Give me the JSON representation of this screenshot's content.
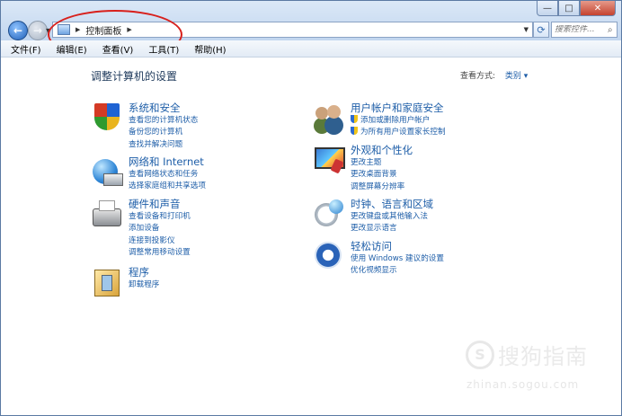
{
  "window": {
    "controls": {
      "minimize": "—",
      "maximize": "□",
      "close": "✕"
    }
  },
  "address_bar": {
    "back": "←",
    "forward": "→",
    "breadcrumb": "控制面板",
    "search_placeholder": "搜索控件..."
  },
  "menu": [
    "文件(F)",
    "编辑(E)",
    "查看(V)",
    "工具(T)",
    "帮助(H)"
  ],
  "page": {
    "title": "调整计算机的设置",
    "view_by_label": "查看方式:",
    "view_by_value": "类别 ▾"
  },
  "categories_left": [
    {
      "icon": "security-shield-icon",
      "title": "系统和安全",
      "links": [
        "查看您的计算机状态",
        "备份您的计算机",
        "查找并解决问题"
      ]
    },
    {
      "icon": "network-globe-icon",
      "title": "网络和 Internet",
      "links": [
        "查看网络状态和任务",
        "选择家庭组和共享选项"
      ]
    },
    {
      "icon": "printer-icon",
      "title": "硬件和声音",
      "links": [
        "查看设备和打印机",
        "添加设备",
        "连接到投影仪",
        "调整常用移动设置"
      ]
    },
    {
      "icon": "programs-icon",
      "title": "程序",
      "links": [
        "卸载程序"
      ]
    }
  ],
  "categories_right": [
    {
      "icon": "users-icon",
      "title": "用户帐户和家庭安全",
      "links": [
        "添加或删除用户帐户",
        "为所有用户设置家长控制"
      ]
    },
    {
      "icon": "display-icon",
      "title": "外观和个性化",
      "links": [
        "更改主题",
        "更改桌面背景",
        "调整屏幕分辨率"
      ]
    },
    {
      "icon": "clock-globe-icon",
      "title": "时钟、语言和区域",
      "links": [
        "更改键盘或其他输入法",
        "更改显示语言"
      ]
    },
    {
      "icon": "accessibility-icon",
      "title": "轻松访问",
      "links": [
        "使用 Windows 建议的设置",
        "优化视频显示"
      ]
    }
  ],
  "watermark": {
    "symbol": "S",
    "name": "搜狗指南",
    "url": "zhinan.sogou.com"
  },
  "colors": {
    "link": "#1e5ea8",
    "annotation": "#d8201c"
  }
}
